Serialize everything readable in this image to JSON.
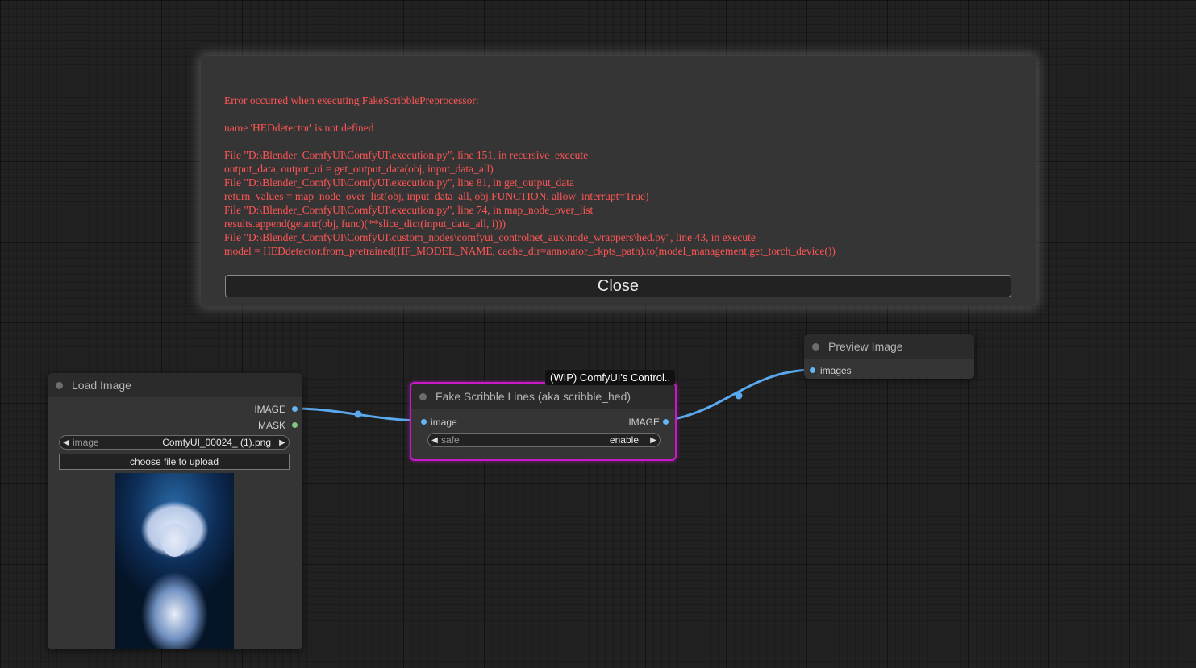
{
  "error_dialog": {
    "lines": [
      "Error occurred when executing FakeScribblePreprocessor:",
      "",
      "name 'HEDdetector' is not defined",
      "",
      "File \"D:\\Blender_ComfyUI\\ComfyUI\\execution.py\", line 151, in recursive_execute",
      "output_data, output_ui = get_output_data(obj, input_data_all)",
      "File \"D:\\Blender_ComfyUI\\ComfyUI\\execution.py\", line 81, in get_output_data",
      "return_values = map_node_over_list(obj, input_data_all, obj.FUNCTION, allow_interrupt=True)",
      "File \"D:\\Blender_ComfyUI\\ComfyUI\\execution.py\", line 74, in map_node_over_list",
      "results.append(getattr(obj, func)(**slice_dict(input_data_all, i)))",
      "File \"D:\\Blender_ComfyUI\\ComfyUI\\custom_nodes\\comfyui_controlnet_aux\\node_wrappers\\hed.py\", line 43, in execute",
      "model = HEDdetector.from_pretrained(HF_MODEL_NAME, cache_dir=annotator_ckpts_path).to(model_management.get_torch_device())"
    ],
    "close_label": "Close"
  },
  "load_image_node": {
    "title": "Load Image",
    "outputs": [
      "IMAGE",
      "MASK"
    ],
    "widget_name": "image",
    "widget_value": "ComfyUI_00024_ (1).png",
    "upload_label": "choose file to upload"
  },
  "group": {
    "label": "(WIP) ComfyUI's Control.."
  },
  "fake_scribble_node": {
    "title": "Fake Scribble Lines (aka scribble_hed)",
    "input": "image",
    "output": "IMAGE",
    "widget_name": "safe",
    "widget_value": "enable"
  },
  "preview_image_node": {
    "title": "Preview Image",
    "input": "images"
  },
  "colors": {
    "image_slot": "#64b5f6",
    "mask_slot": "#81c784",
    "error_text": "#ff5555",
    "group_border": "#c91ac9"
  }
}
